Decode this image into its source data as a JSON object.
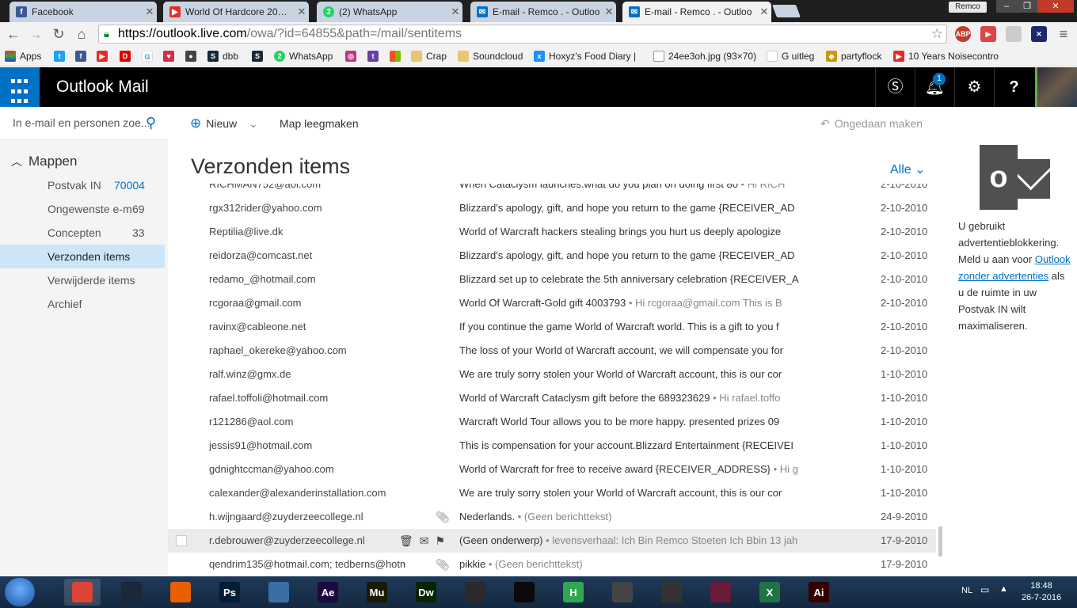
{
  "browser": {
    "tabs": [
      {
        "label": "Facebook",
        "icon": "facebook-icon",
        "color": "#3b5998"
      },
      {
        "label": "World Of Hardcore 20…",
        "icon": "youtube-icon",
        "color": "#e52d27"
      },
      {
        "label": "(2) WhatsApp",
        "icon": "whatsapp-icon",
        "color": "#25d366"
      },
      {
        "label": "E-mail - Remco . - Outloo",
        "icon": "outlook-icon",
        "color": "#0072c6"
      },
      {
        "label": "E-mail - Remco . - Outloo",
        "icon": "outlook-icon",
        "color": "#0072c6"
      }
    ],
    "profile": "Remco",
    "url_host": "https://outlook.live.com",
    "url_path": "/owa/?id=64855&path=/mail/sentitems",
    "bookmarks": [
      {
        "label": "Apps"
      },
      {
        "label": ""
      },
      {
        "label": ""
      },
      {
        "label": ""
      },
      {
        "label": ""
      },
      {
        "label": ""
      },
      {
        "label": ""
      },
      {
        "label": ""
      },
      {
        "label": "dbb"
      },
      {
        "label": ""
      },
      {
        "label": "WhatsApp"
      },
      {
        "label": ""
      },
      {
        "label": ""
      },
      {
        "label": ""
      },
      {
        "label": "Crap"
      },
      {
        "label": "Soundcloud"
      },
      {
        "label": "Hoxyz's Food Diary | "
      },
      {
        "label": "24ee3oh.jpg (93×70)"
      },
      {
        "label": "G uitleg"
      },
      {
        "label": "partyflock"
      },
      {
        "label": "10 Years Noisecontro"
      }
    ]
  },
  "header": {
    "app_title": "Outlook Mail",
    "notification_count": "1"
  },
  "search": {
    "placeholder": "In e-mail en personen zoe..."
  },
  "folders": {
    "heading": "Mappen",
    "items": [
      {
        "label": "Postvak IN",
        "count": "70004"
      },
      {
        "label": "Ongewenste e-m",
        "count": "69"
      },
      {
        "label": "Concepten",
        "count": "33"
      },
      {
        "label": "Verzonden items",
        "count": ""
      },
      {
        "label": "Verwijderde items",
        "count": ""
      },
      {
        "label": "Archief",
        "count": ""
      }
    ]
  },
  "commands": {
    "new": "Nieuw",
    "empty_folder": "Map leegmaken",
    "undo": "Ongedaan maken"
  },
  "view": {
    "title": "Verzonden items",
    "filter": "Alle"
  },
  "messages": [
    {
      "from": "RICHMAN752@aol.com",
      "subject": "When Cataclysm launches.what do you plan on doing first 80",
      "preview": " • Hi RICH",
      "date": "2-10-2010"
    },
    {
      "from": "rgx312rider@yahoo.com",
      "subject": "Blizzard's apology, gift, and hope you return to the game {RECEIVER_AD",
      "preview": "",
      "date": "2-10-2010"
    },
    {
      "from": "Reptilia@live.dk",
      "subject": "World of Warcraft hackers stealing brings you hurt us deeply apologize",
      "preview": "",
      "date": "2-10-2010"
    },
    {
      "from": "reidorza@comcast.net",
      "subject": "Blizzard's apology, gift, and hope you return to the game {RECEIVER_AD",
      "preview": "",
      "date": "2-10-2010"
    },
    {
      "from": "redamo_@hotmail.com",
      "subject": "Blizzard set up to celebrate the 5th anniversary celebration {RECEIVER_A",
      "preview": "",
      "date": "2-10-2010"
    },
    {
      "from": "rcgoraa@gmail.com",
      "subject": "World Of Warcraft-Gold gift 4003793",
      "preview": " • Hi rcgoraa@gmail.com  This is B",
      "date": "2-10-2010"
    },
    {
      "from": "ravinx@cableone.net",
      "subject": "If you continue the game World of Warcraft world. This is a gift to you f",
      "preview": "",
      "date": "2-10-2010"
    },
    {
      "from": "raphael_okereke@yahoo.com",
      "subject": "The loss of your World of Warcraft account, we will compensate you for",
      "preview": "",
      "date": "2-10-2010"
    },
    {
      "from": "ralf.winz@gmx.de",
      "subject": "We are truly sorry stolen your World of Warcraft account, this is our cor",
      "preview": "",
      "date": "1-10-2010"
    },
    {
      "from": "rafael.toffoli@hotmail.com",
      "subject": "World of Warcraft Cataclysm gift before the 689323629",
      "preview": " • Hi rafael.toffo",
      "date": "1-10-2010"
    },
    {
      "from": "r121286@aol.com",
      "subject": "Warcraft World Tour allows you to be more happy. presented prizes 09",
      "preview": "",
      "date": "1-10-2010"
    },
    {
      "from": "jessis91@hotmail.com",
      "subject": "This is compensation for your account.Blizzard Entertainment {RECEIVEI",
      "preview": "",
      "date": "1-10-2010"
    },
    {
      "from": "gdnightccman@yahoo.com",
      "subject": "World of Warcraft for free to receive award {RECEIVER_ADDRESS}",
      "preview": " • Hi g",
      "date": "1-10-2010"
    },
    {
      "from": "calexander@alexanderinstallation.com",
      "subject": "We are truly sorry stolen your World of Warcraft account, this is our cor",
      "preview": "",
      "date": "1-10-2010"
    },
    {
      "from": "h.wijngaard@zuyderzeecollege.nl",
      "subject": "Nederlands.",
      "preview": " • (Geen berichttekst)",
      "date": "24-9-2010"
    },
    {
      "from": "r.debrouwer@zuyderzeecollege.nl",
      "subject": "(Geen onderwerp)",
      "preview": " • levensverhaal: Ich Bin Remco Stoeten Ich Bbin 13 jah",
      "date": "17-9-2010"
    },
    {
      "from": "qendrim135@hotmail.com; tedberns@hotm",
      "subject": "pikkie",
      "preview": " • (Geen berichttekst)",
      "date": "17-9-2010"
    }
  ],
  "ad": {
    "text1": "U gebruikt advertentieblokkering. Meld u aan voor ",
    "link": "Outlook zonder advertenties",
    "text2": " als u de ruimte in uw Postvak IN wilt maximaliseren."
  },
  "taskbar": {
    "language": "NL",
    "time": "18:48",
    "date": "26-7-2016",
    "apps": [
      {
        "name": "chrome-icon",
        "label": "",
        "color": "#db4437"
      },
      {
        "name": "steam-icon",
        "label": "",
        "color": "#1b2838"
      },
      {
        "name": "firefox-icon",
        "label": "",
        "color": "#e66000"
      },
      {
        "name": "photoshop-icon",
        "label": "Ps",
        "color": "#001e36"
      },
      {
        "name": "keyboard-icon",
        "label": "",
        "color": "#3a6ea5"
      },
      {
        "name": "after-effects-icon",
        "label": "Ae",
        "color": "#1f0740"
      },
      {
        "name": "muse-icon",
        "label": "Mu",
        "color": "#1a1a00"
      },
      {
        "name": "dreamweaver-icon",
        "label": "Dw",
        "color": "#072401"
      },
      {
        "name": "video-icon",
        "label": "",
        "color": "#2a2a2a"
      },
      {
        "name": "razer-icon",
        "label": "",
        "color": "#0a0a0a"
      },
      {
        "name": "h-app-icon",
        "label": "H",
        "color": "#2fa84f"
      },
      {
        "name": "monitor-icon",
        "label": "",
        "color": "#444"
      },
      {
        "name": "circle-app-icon",
        "label": "",
        "color": "#333"
      },
      {
        "name": "game-icon",
        "label": "",
        "color": "#6a1a3a"
      },
      {
        "name": "excel-icon",
        "label": "X",
        "color": "#217346"
      },
      {
        "name": "illustrator-icon",
        "label": "Ai",
        "color": "#330000"
      }
    ]
  }
}
